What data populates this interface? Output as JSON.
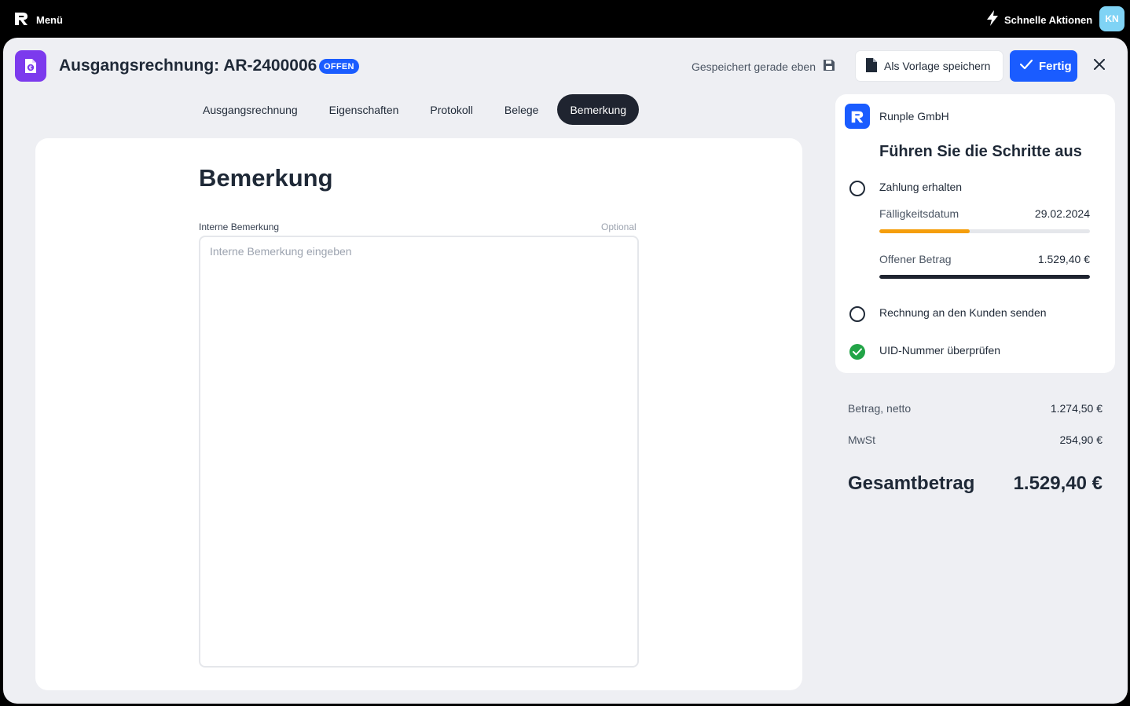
{
  "topbar": {
    "menu_label": "Menü",
    "quick_actions_label": "Schnelle Aktionen",
    "avatar_initials": "KN"
  },
  "header": {
    "title": "Ausgangsrechnung: AR-2400006",
    "status_badge": "OFFEN",
    "saved_status": "Gespeichert gerade eben",
    "template_button": "Als Vorlage speichern",
    "done_button": "Fertig"
  },
  "tabs": [
    {
      "label": "Ausgangsrechnung",
      "active": false
    },
    {
      "label": "Eigenschaften",
      "active": false
    },
    {
      "label": "Protokoll",
      "active": false
    },
    {
      "label": "Belege",
      "active": false
    },
    {
      "label": "Bemerkung",
      "active": true
    }
  ],
  "main": {
    "title": "Bemerkung",
    "field_label": "Interne Bemerkung",
    "field_optional": "Optional",
    "field_placeholder": "Interne Bemerkung eingeben",
    "field_value": ""
  },
  "steps_card": {
    "company": "Runple GmbH",
    "title": "Führen Sie die Schritte aus",
    "steps": [
      {
        "label": "Zahlung erhalten",
        "done": false
      },
      {
        "label": "Rechnung an den Kunden senden",
        "done": false
      },
      {
        "label": "UID-Nummer überprüfen",
        "done": true
      }
    ],
    "due_date_label": "Fälligkeitsdatum",
    "due_date_value": "29.02.2024",
    "due_progress": 0.43,
    "open_amount_label": "Offener Betrag",
    "open_amount_value": "1.529,40 €",
    "open_progress": 1.0
  },
  "totals": {
    "net_label": "Betrag, netto",
    "net_value": "1.274,50 €",
    "vat_label": "MwSt",
    "vat_value": "254,90 €",
    "gross_label": "Gesamtbetrag",
    "gross_value": "1.529,40 €"
  },
  "colors": {
    "accent": "#1a5cff",
    "purple": "#7c3aed",
    "orange": "#f59e0b",
    "dark": "#1f2430",
    "success": "#22a447"
  }
}
